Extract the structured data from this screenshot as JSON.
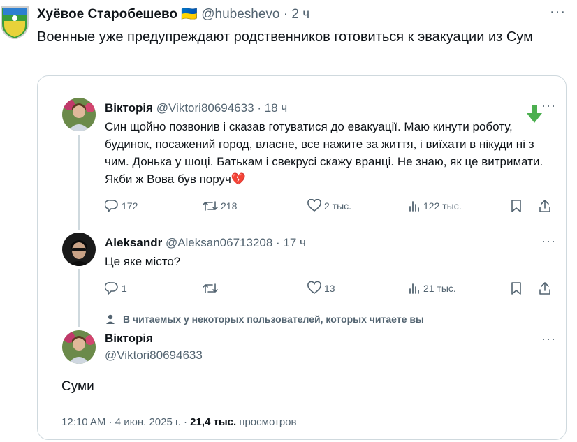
{
  "outer": {
    "author_name": "Хуёвое Старобешево",
    "flag": "🇺🇦",
    "handle": "@hubeshevo",
    "separator": " · ",
    "time": "2 ч",
    "more": "···",
    "text": "Военные уже предупреждают родственников готовиться к эвакуации из Сум"
  },
  "quote": {
    "tweets": [
      {
        "name": "Вікторія",
        "handle": "@Viktori80694633",
        "separator": " · ",
        "time": "18 ч",
        "more": "···",
        "text": "Син щойно позвонив і сказав готуватися до евакуації. Маю кинути роботу, будинок, посажений город, власне, все нажите за життя, і виїхати в нікуди ні з чим. Донька у шоці. Батькам і свекрусі скажу вранці. Не знаю, як це витримати. Якби ж Вова був поруч",
        "emoji": "💔",
        "actions": {
          "replies": "172",
          "retweets": "218",
          "likes": "2 тыс.",
          "views": "122 тыс."
        }
      },
      {
        "name": "Aleksandr",
        "handle": "@Aleksan06713208",
        "separator": " · ",
        "time": "17 ч",
        "more": "···",
        "text": "Це яке місто?",
        "actions": {
          "replies": "1",
          "retweets": "",
          "likes": "13",
          "views": "21 тыс."
        }
      }
    ],
    "social_context": "В читаемых у некоторых пользователей, которых читаете вы",
    "reply": {
      "name": "Вікторія",
      "handle": "@Viktori80694633",
      "more": "···",
      "text": "Суми",
      "time": "12:10 AM · 4 июн. 2025 г. · ",
      "views_count": "21,4 тыс.",
      "views_label": " просмотров"
    }
  },
  "icons": [
    "reply-icon",
    "retweet-icon",
    "like-icon",
    "views-icon",
    "bookmark-icon",
    "share-icon",
    "person-icon",
    "broken-heart-emoji",
    "down-arrow-icon"
  ],
  "colors": {
    "text": "#0f1419",
    "muted": "#536471",
    "border": "#cfd9de",
    "arrow": "#4caf50",
    "broken_heart": "#e0245e"
  }
}
